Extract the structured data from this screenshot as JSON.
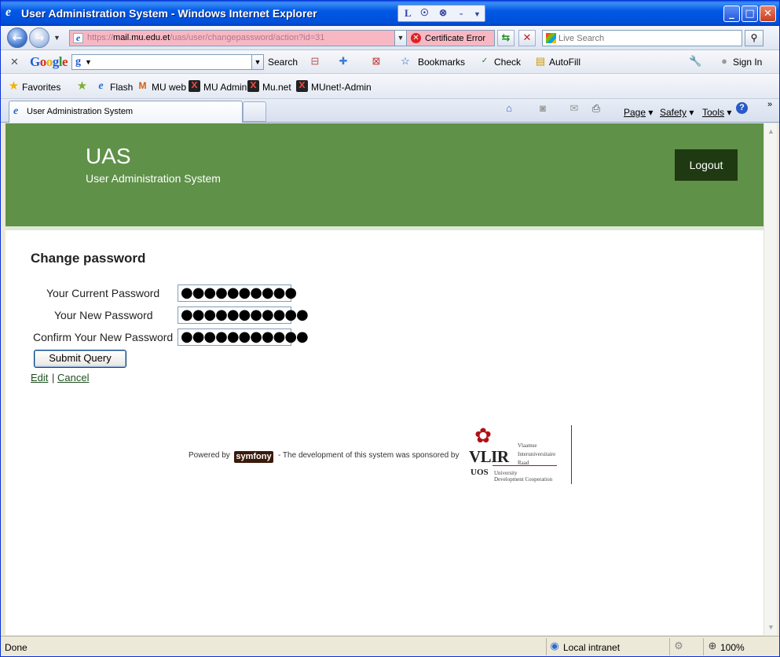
{
  "window": {
    "title": "User Administration System - Windows Internet Explorer"
  },
  "address_bar": {
    "url_scheme": "https://",
    "url_host": "mail.mu.edu.et",
    "url_path": "/uas/user/changepassword/action?id=31",
    "cert_error_label": "Certificate Error"
  },
  "live_search": {
    "placeholder": "Live Search"
  },
  "google_toolbar": {
    "search_label": "Search",
    "bookmarks_label": "Bookmarks",
    "check_label": "Check",
    "autofill_label": "AutoFill",
    "signin_label": "Sign In"
  },
  "favorites_bar": {
    "favorites_label": "Favorites",
    "items": [
      "Flash",
      "MU web",
      "MU Admin",
      "Mu.net",
      "MUnet!-Admin"
    ]
  },
  "tab": {
    "label": "User Administration System"
  },
  "commands": {
    "page": "Page",
    "safety": "Safety",
    "tools": "Tools"
  },
  "site": {
    "title": "UAS",
    "subtitle": "User Administration System",
    "logout_label": "Logout"
  },
  "form": {
    "heading": "Change password",
    "current_label": "Your Current Password",
    "current_value": "●●●●●●●●●●",
    "new_label": "Your New Password",
    "new_value": "●●●●●●●●●●●",
    "confirm_label": "Confirm Your New Password",
    "confirm_value": "●●●●●●●●●●●",
    "submit_label": "Submit Query",
    "edit_link": "Edit",
    "separator": "|",
    "cancel_link": "Cancel"
  },
  "footer": {
    "powered_by": "Powered by",
    "symfony": "symfony",
    "sponsor_text": "-  The development of this system was sponsored by",
    "vlir": "VLIR",
    "vlir_lines": [
      "Vlaamse",
      "Interuniversitaire",
      "Raad"
    ],
    "uos": "UOS",
    "uos_lines": [
      "University",
      "Development Cooperation"
    ]
  },
  "status_bar": {
    "status": "Done",
    "zone": "Local intranet",
    "zoom": "100%"
  }
}
